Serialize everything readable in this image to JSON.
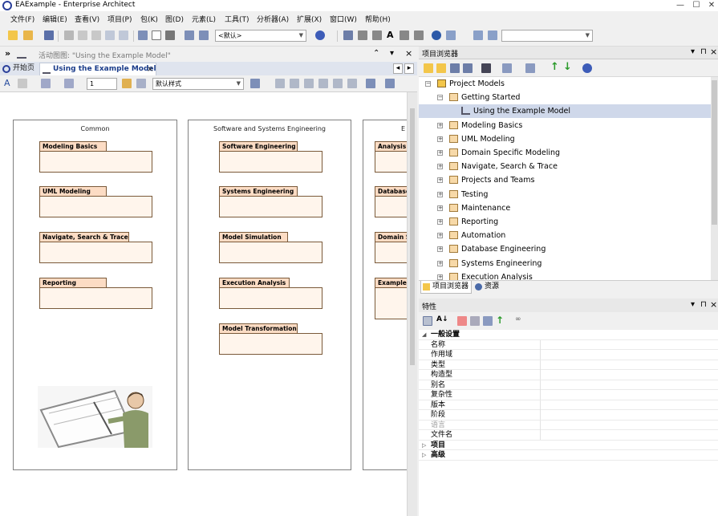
{
  "window": {
    "title": "EAExample - Enterprise Architect",
    "controls": [
      "—",
      "☐",
      "✕"
    ]
  },
  "menubar": {
    "items": [
      "文件(F)",
      "编辑(E)",
      "查看(V)",
      "项目(P)",
      "包(K)",
      "图(D)",
      "元素(L)",
      "工具(T)",
      "分析器(A)",
      "扩展(X)",
      "窗口(W)",
      "帮助(H)"
    ]
  },
  "toolbar": {
    "default_combo": "<默认>",
    "search_combo": ""
  },
  "diagram_header": {
    "expander": "»",
    "label": "活动图图: \"Using the Example Model\"",
    "collapse": "⌃",
    "pin": "▾",
    "close": "×"
  },
  "tabs": {
    "start_page": "开始页",
    "diagram": "Using the Example Model",
    "close": "×",
    "nav_left": "◂",
    "nav_right": "▸"
  },
  "diagram_toolbar": {
    "font_size": "1",
    "style_combo": "默认样式"
  },
  "diagram": {
    "boundaries": [
      {
        "title": "Common",
        "packages": [
          "Modeling Basics",
          "UML Modeling",
          "Navigate, Search & Trace",
          "Reporting"
        ]
      },
      {
        "title": "Software and Systems Engineering",
        "packages": [
          "Software Engineering",
          "Systems Engineering",
          "Model Simulation",
          "Execution Analysis",
          "Model Transformation"
        ]
      },
      {
        "title": "E",
        "packages": [
          "Analysis",
          "Database",
          "Domain S",
          "Example"
        ]
      }
    ]
  },
  "project_browser": {
    "title": "项目浏览器",
    "header_controls": [
      "▾",
      "⊓",
      "×"
    ],
    "tree": [
      {
        "label": "Project Models",
        "level": 0,
        "expander": "⊟",
        "icon": "root-model-icon"
      },
      {
        "label": "Getting Started",
        "level": 1,
        "expander": "⊟",
        "icon": "package-icon"
      },
      {
        "label": "Using the Example Model",
        "level": 2,
        "expander": "",
        "icon": "diagram-icon",
        "selected": true
      },
      {
        "label": "Modeling Basics",
        "level": 1,
        "expander": "⊞",
        "icon": "package-icon"
      },
      {
        "label": "UML Modeling",
        "level": 1,
        "expander": "⊞",
        "icon": "package-icon"
      },
      {
        "label": "Domain Specific Modeling",
        "level": 1,
        "expander": "⊞",
        "icon": "package-icon"
      },
      {
        "label": "Navigate, Search & Trace",
        "level": 1,
        "expander": "⊞",
        "icon": "package-icon"
      },
      {
        "label": "Projects and Teams",
        "level": 1,
        "expander": "⊞",
        "icon": "package-icon"
      },
      {
        "label": "Testing",
        "level": 1,
        "expander": "⊞",
        "icon": "package-icon"
      },
      {
        "label": "Maintenance",
        "level": 1,
        "expander": "⊞",
        "icon": "package-icon"
      },
      {
        "label": "Reporting",
        "level": 1,
        "expander": "⊞",
        "icon": "package-icon"
      },
      {
        "label": "Automation",
        "level": 1,
        "expander": "⊞",
        "icon": "package-icon"
      },
      {
        "label": "Database Engineering",
        "level": 1,
        "expander": "⊞",
        "icon": "package-icon"
      },
      {
        "label": "Systems Engineering",
        "level": 1,
        "expander": "⊞",
        "icon": "package-icon"
      },
      {
        "label": "Execution Analysis",
        "level": 1,
        "expander": "⊞",
        "icon": "package-icon"
      }
    ],
    "bottom_tabs": [
      "项目浏览器",
      "资源"
    ]
  },
  "properties": {
    "title": "特性",
    "header_controls": [
      "▾",
      "⊓",
      "×"
    ],
    "rows": [
      {
        "key": "一般设置",
        "type": "category",
        "expanded": true
      },
      {
        "key": "名称",
        "type": "field"
      },
      {
        "key": "作用域",
        "type": "field"
      },
      {
        "key": "类型",
        "type": "field"
      },
      {
        "key": "构造型",
        "type": "field"
      },
      {
        "key": "别名",
        "type": "field"
      },
      {
        "key": "复杂性",
        "type": "field"
      },
      {
        "key": "版本",
        "type": "field"
      },
      {
        "key": "阶段",
        "type": "field"
      },
      {
        "key": "语言",
        "type": "field",
        "disabled": true
      },
      {
        "key": "文件名",
        "type": "field"
      },
      {
        "key": "项目",
        "type": "category",
        "expanded": false
      },
      {
        "key": "高级",
        "type": "category",
        "expanded": false
      }
    ]
  },
  "colors": {
    "package_tab": "#fcdcc4",
    "package_body": "#fff5ec",
    "selection": "#cfd8ea",
    "accent": "#1a3c8a"
  }
}
